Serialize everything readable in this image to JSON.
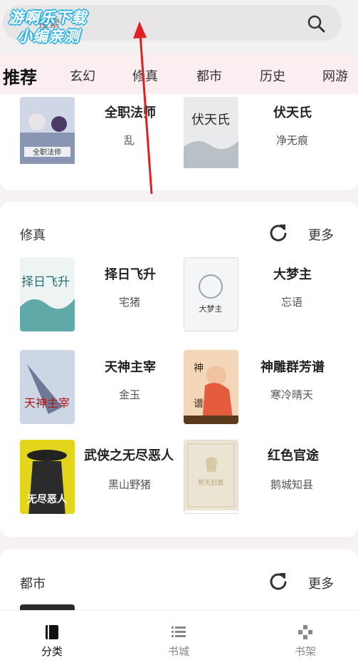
{
  "watermark": {
    "line1": "游啊乐下载",
    "line2": "小编亲测"
  },
  "search": {
    "placeholder": "搜索"
  },
  "categories": [
    "推荐",
    "玄幻",
    "修真",
    "都市",
    "历史",
    "网游"
  ],
  "section_top": {
    "books": [
      {
        "title": "全职法师",
        "author": "乱"
      },
      {
        "title": "伏天氏",
        "author": "净无痕"
      }
    ]
  },
  "section_xiuzhen": {
    "title": "修真",
    "more": "更多",
    "books": [
      {
        "title": "择日飞升",
        "author": "宅猪"
      },
      {
        "title": "大梦主",
        "author": "忘语"
      },
      {
        "title": "天神主宰",
        "author": "金玉"
      },
      {
        "title": "神雕群芳谱",
        "author": "寒冷晴天"
      },
      {
        "title": "武侠之无尽恶人",
        "author": "黑山野猪"
      },
      {
        "title": "红色官途",
        "author": "鹅城知县"
      }
    ]
  },
  "section_dushi": {
    "title": "都市",
    "more": "更多"
  },
  "bottom_nav": [
    {
      "label": "分类",
      "icon": "book-icon"
    },
    {
      "label": "书城",
      "icon": "list-icon"
    },
    {
      "label": "书架",
      "icon": "gamepad-icon"
    }
  ],
  "colors": {
    "accent_tab_bg": "#fbeef1",
    "arrow": "#e02020"
  }
}
